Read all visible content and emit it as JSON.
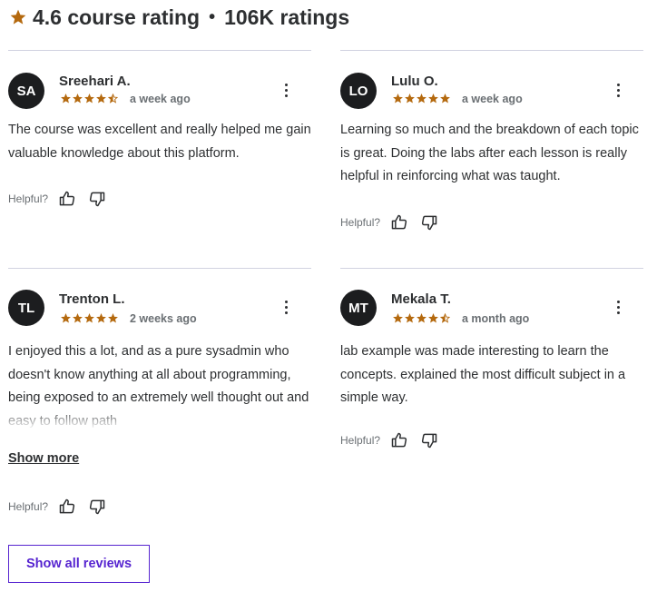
{
  "header": {
    "rating": "4.6 course rating",
    "separator": "•",
    "count": "106K ratings",
    "star_color": "#b4690e"
  },
  "reviews": [
    {
      "initials": "SA",
      "name": "Sreehari A.",
      "rating": 4.5,
      "date": "a week ago",
      "text": "The course was excellent and really helped me gain valuable knowledge about this platform.",
      "helpful_label": "Helpful?"
    },
    {
      "initials": "LO",
      "name": "Lulu O.",
      "rating": 5,
      "date": "a week ago",
      "text": "Learning so much and the breakdown of each topic is great. Doing the labs after each lesson is really helpful in reinforcing what was taught.",
      "helpful_label": "Helpful?"
    },
    {
      "initials": "TL",
      "name": "Trenton L.",
      "rating": 5,
      "date": "2 weeks ago",
      "text": "I enjoyed this a lot, and as a pure sysadmin who doesn't know anything at all about programming, being exposed to an extremely well thought out and easy to follow path",
      "helpful_label": "Helpful?",
      "show_more_label": "Show more"
    },
    {
      "initials": "MT",
      "name": "Mekala T.",
      "rating": 4.5,
      "date": "a month ago",
      "text": "lab example was made interesting to learn the concepts. explained the most difficult subject in a simple way.",
      "helpful_label": "Helpful?"
    }
  ],
  "show_all_label": "Show all reviews",
  "icons": {
    "star": "star-icon",
    "half_star": "half-star-icon",
    "more": "more-options-icon",
    "thumbs_up": "thumbs-up-icon",
    "thumbs_down": "thumbs-down-icon"
  }
}
